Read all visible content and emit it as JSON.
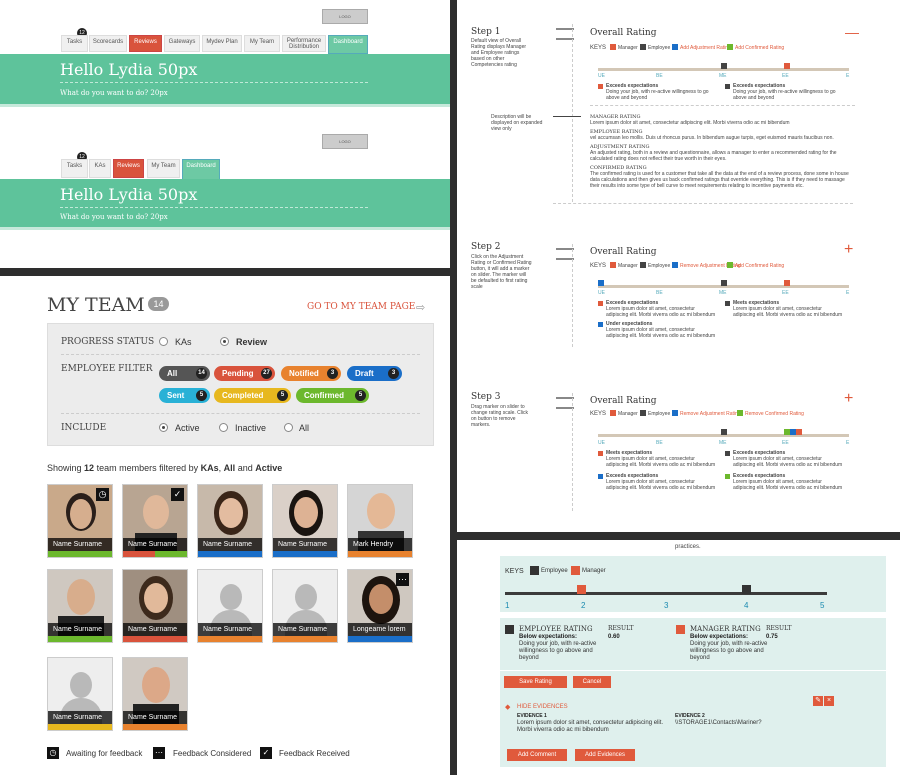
{
  "nav1": {
    "tabs": [
      "Tasks",
      "Scorecards",
      "Reviews",
      "Gateways",
      "Mydev Plan",
      "My Team",
      "Performance Distribution",
      "Dashboard"
    ],
    "badge": "12",
    "logo": "LOGO",
    "hello": "Hello Lydia 50px",
    "sub": "What do you want to do? 20px"
  },
  "nav2": {
    "tabs": [
      "Tasks",
      "KAs",
      "Reviews",
      "My Team",
      "Dashboard"
    ],
    "badge": "12",
    "logo": "LOGO",
    "hello": "Hello Lydia 50px",
    "sub": "What do you want to do? 20px"
  },
  "team": {
    "title": "MY TEAM",
    "count": "14",
    "goto": "GO TO MY TEAM PAGE",
    "progress_label": "PROGRESS STATUS",
    "progress_opts": [
      "KAs",
      "Review"
    ],
    "filter_label": "EMPLOYEE FILTER",
    "filters": [
      {
        "label": "All",
        "count": "14",
        "color": "#555"
      },
      {
        "label": "Pending",
        "count": "27",
        "color": "#d9533c"
      },
      {
        "label": "Notified",
        "count": "3",
        "color": "#e8822e"
      },
      {
        "label": "Draft",
        "count": "3",
        "color": "#1a6ec8"
      },
      {
        "label": "Sent",
        "count": "5",
        "color": "#29b1d6"
      },
      {
        "label": "Completed",
        "count": "5",
        "color": "#e7b81f"
      },
      {
        "label": "Confirmed",
        "count": "5",
        "color": "#6cb82d"
      }
    ],
    "include_label": "INCLUDE",
    "include_opts": [
      "Active",
      "Inactive",
      "All"
    ],
    "showing_pre": "Showing",
    "showing_n": "12",
    "showing_mid": "team members filtered by",
    "showing_f1": "KAs",
    "showing_f2": "All",
    "showing_and": "and",
    "showing_f3": "Active",
    "members": [
      "Name Surname",
      "Name Surname",
      "Name Surname",
      "Name Surname",
      "Mark Hendry",
      "Name Surname",
      "Name Surname",
      "Name Surname",
      "Name Surname",
      "Longeame lorem",
      "Name Surname",
      "Name Surname"
    ],
    "legend": [
      "Awaiting for feedback",
      "Feedback Considered",
      "Feedback Received"
    ]
  },
  "rating": {
    "title": "Overall Rating",
    "keys_label": "KEYS",
    "manager": "Manager",
    "employee": "Employee",
    "add_adj": "Add Adjustment Rating",
    "add_conf": "Add Confirmed Rating",
    "remove_adj": "Remove Adjustment Rating",
    "remove_conf": "Remove Confirmed Rating",
    "ticks": [
      "UE",
      "BE",
      "ME",
      "EE",
      "E"
    ],
    "step1": "Step 1",
    "step1_desc": "Default view of Overall Rating displays Manager and Employee ratings based on other Competencies rating",
    "step2": "Step 2",
    "step2_desc": "Click on the Adjustment Rating or Confirmed Rating button, it will add a marker on slider. The marker will be defaulted to first rating scale",
    "step3": "Step 3",
    "step3_desc": "Drag marker on slider to change rating scale. Click on button to remove markers.",
    "desc_note": "Description will be displayed on expanded view only",
    "exceeds": "Exceeds expectations",
    "meets": "Meets expectations",
    "under": "Under expectations",
    "lorem_short": "Doing your job, with re-active willingness to go above and beyond",
    "lorem2": "Lorem ipsum dolor sit amet, consectetur adipiscing elit. Morbi viverra odio ac mi bibendum",
    "mgr_h": "MANAGER RATING",
    "mgr_t": "Lorem ipsum dolor sit amet, consectetur adipiscing elit. Morbi viverra odio ac mi bibendum",
    "emp_h": "EMPLOYEE RATING",
    "emp_t": "vel accumsan leo mollis. Duis ut rhoncus purus. In bibendum augue turpis, eget euismod mauris faucibus non.",
    "adj_h": "ADJUSTMENT RATING",
    "adj_t": "An adjusted rating, both in a review and questionnaire, allows a manager to enter a recommended rating for the calculated rating does not reflect their true worth in their eyes.",
    "conf_h": "CONFIRMED RATING",
    "conf_t": "The confirmed rating is used for a customer that take all the data at the end of a review process, done some in house data calculations and then gives us back confirmed ratings that override everything. This is if they need to massage their results into some type of bell curve to meet requirements relating to incentive payments etc."
  },
  "detail": {
    "practices": "practices.",
    "keys": "KEYS",
    "employee": "Employee",
    "manager": "Manager",
    "scale": [
      "1",
      "2",
      "3",
      "4",
      "5"
    ],
    "emp_rating": "EMPLOYEE RATING",
    "mgr_rating": "MANAGER RATING",
    "result": "RESULT",
    "below": "Below expectations:",
    "below_txt": "Doing your job, with re-active willingness to go above and beyond",
    "emp_val": "0.60",
    "mgr_val": "0.75",
    "save": "Save Rating",
    "cancel": "Cancel",
    "hide": "HIDE EVIDENCES",
    "ev1": "EVIDENCE 1",
    "ev1_txt": "Lorem ipsum dolor sit amet, consectetur adipiscing elit. Morbi viverra odio ac mi bibendum",
    "ev2": "EVIDENCE 2",
    "ev2_txt": "\\\\STORAGE1\\Contacts\\Mariner?",
    "add_comment": "Add Comment",
    "add_ev": "Add Evidences"
  }
}
